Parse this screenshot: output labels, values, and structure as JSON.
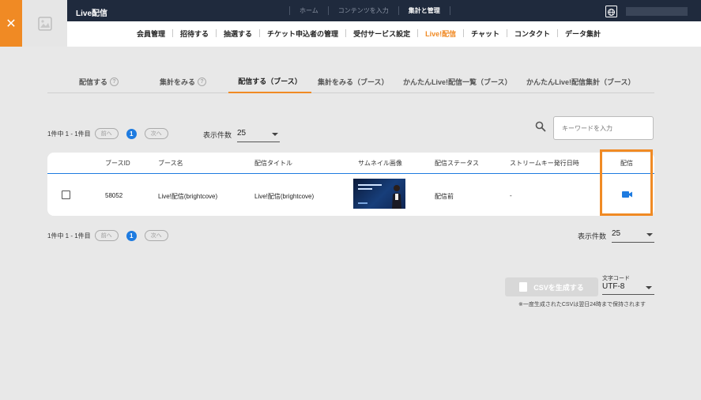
{
  "app": {
    "title": "Live配信"
  },
  "topnav": [
    "ホーム",
    "コンテンツを入力",
    "集計と管理"
  ],
  "mainnav": [
    "会員管理",
    "招待する",
    "抽選する",
    "チケット申込者の管理",
    "受付サービス設定",
    "Live!配信",
    "チャット",
    "コンタクト",
    "データ集計"
  ],
  "tabs": [
    "配信する",
    "集計をみる",
    "配信する（ブース）",
    "集計をみる（ブース）",
    "かんたんLive!配信一覧（ブース）",
    "かんたんLive!配信集計（ブース）"
  ],
  "pager": {
    "info": "1件中 1 - 1件目",
    "prev": "前へ",
    "page": "1",
    "next": "次へ"
  },
  "perpage": {
    "label": "表示件数",
    "value": "25"
  },
  "search": {
    "placeholder": "キーワードを入力"
  },
  "table": {
    "headers": [
      "ブースID",
      "ブース名",
      "配信タイトル",
      "サムネイル画像",
      "配信ステータス",
      "ストリームキー発行日時",
      "配信"
    ],
    "row": {
      "booth_id": "58052",
      "booth_name": "Live!配信(brightcove)",
      "title": "Live!配信(brightcove)",
      "status": "配信前",
      "stream_key_date": "-"
    }
  },
  "csv": {
    "button": "CSVを生成する",
    "charset_label": "文字コード",
    "charset_value": "UTF-8",
    "note": "※一度生成されたCSVは翌日24時まで保持されます"
  },
  "colors": {
    "accent": "#f08a24",
    "primary": "#1e7be0",
    "header": "#1f2a3d"
  }
}
